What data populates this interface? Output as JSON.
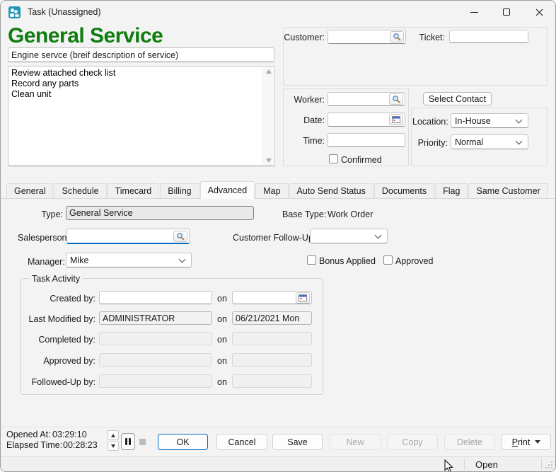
{
  "colors": {
    "accent_green": "#0e7c0e",
    "focus_blue": "#0067c0"
  },
  "titlebar": {
    "title": "Task (Unassigned)"
  },
  "header": {
    "title": "General Service",
    "description": "Engine servce (breif description of service)",
    "notes": "Review attached check list\nRecord any parts\nClean unit"
  },
  "customer_panel": {
    "customer_label": "Customer:",
    "customer_value": "",
    "ticket_label": "Ticket:",
    "ticket_value": ""
  },
  "assignment_panel": {
    "worker_label": "Worker:",
    "worker_value": "",
    "date_label": "Date:",
    "date_value": "",
    "time_label": "Time:",
    "time_value": "",
    "confirmed_label": "Confirmed",
    "confirmed_checked": false
  },
  "contact_panel": {
    "select_contact_label": "Select Contact",
    "location_label": "Location:",
    "location_value": "In-House",
    "priority_label": "Priority:",
    "priority_value": "Normal"
  },
  "tabs": [
    "General",
    "Schedule",
    "Timecard",
    "Billing",
    "Advanced",
    "Map",
    "Auto Send Status",
    "Documents",
    "Flag",
    "Same Customer"
  ],
  "active_tab": "Advanced",
  "advanced_tab": {
    "type_label": "Type:",
    "type_value": "General Service",
    "base_type_label": "Base Type:",
    "base_type_value": "Work Order",
    "salesperson_label": "Salesperson:",
    "salesperson_value": "",
    "customer_followup_label": "Customer Follow-Up:",
    "customer_followup_value": "",
    "manager_label": "Manager:",
    "manager_value": "Mike",
    "bonus_applied_label": "Bonus Applied",
    "bonus_applied_checked": false,
    "approved_label": "Approved",
    "approved_checked": false,
    "task_activity": {
      "legend": "Task Activity",
      "on_label": "on",
      "rows": [
        {
          "label": "Created by:",
          "by": "",
          "on": ""
        },
        {
          "label": "Last Modified by:",
          "by": "ADMINISTRATOR",
          "on": "06/21/2021 Mon"
        },
        {
          "label": "Completed by:",
          "by": "",
          "on": ""
        },
        {
          "label": "Approved by:",
          "by": "",
          "on": ""
        },
        {
          "label": "Followed-Up by:",
          "by": "",
          "on": ""
        }
      ]
    }
  },
  "footer": {
    "opened_at_label": "Opened At:",
    "opened_at_value": "03:29:10",
    "elapsed_time_label": "Elapsed Time:",
    "elapsed_time_value": "00:28:23",
    "ok": "OK",
    "cancel": "Cancel",
    "save": "Save",
    "new": "New",
    "copy": "Copy",
    "delete": "Delete",
    "print_accel": "P",
    "print_rest": "rint"
  },
  "statusbar": {
    "status": "Open"
  },
  "icons": [
    "search-icon",
    "calendar-icon",
    "chevron-down-icon",
    "pause-icon",
    "stop-icon",
    "spinner-up-icon",
    "spinner-down-icon",
    "minimize-icon",
    "maximize-icon",
    "close-icon",
    "scroll-up-icon",
    "scroll-down-icon",
    "resize-grip-icon",
    "cursor-arrow-icon",
    "app-icon"
  ]
}
